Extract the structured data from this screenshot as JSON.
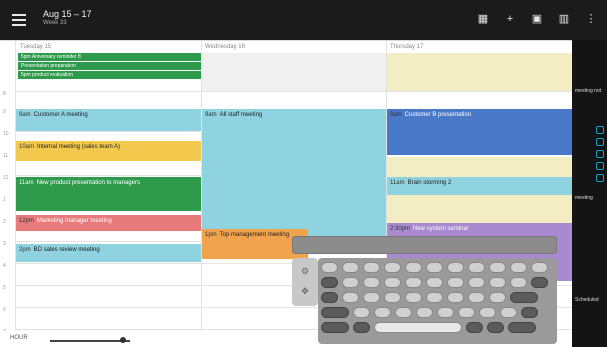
{
  "topbar": {
    "title": "Aug 15 – 17",
    "subtitle": "Week 33",
    "icons": [
      "hamburger-icon",
      "today-icon",
      "add-icon",
      "day-view-icon",
      "week-view-icon",
      "more-icon"
    ]
  },
  "days": [
    "Tuesday 15",
    "Wednesday 16",
    "Thursday 17"
  ],
  "all_day": [
    "5pm Aniversary reminder 8",
    "Presentation preparation",
    "5pm product evaluation"
  ],
  "events": [
    {
      "time": "9am",
      "title": "Customer A meeting"
    },
    {
      "time": "9am",
      "title": "All staff meeting"
    },
    {
      "time": "9am",
      "title": "Customer B presentation"
    },
    {
      "time": "10am",
      "title": "Internal meeting (sales team A)"
    },
    {
      "time": "11am",
      "title": "New product presentation to managers"
    },
    {
      "time": "11am",
      "title": "Brain storming 2"
    },
    {
      "time": "12pm",
      "title": "Marketing manager meeting"
    },
    {
      "time": "1pm",
      "title": "Top management meeting"
    },
    {
      "time": "2:30pm",
      "title": "New system seminar"
    },
    {
      "time": "2pm",
      "title": "BD sales review meeting"
    }
  ],
  "times": [
    "8",
    "9",
    "10",
    "11",
    "12",
    "1",
    "2",
    "3",
    "4",
    "5",
    "6",
    "7"
  ],
  "rightpanel": {
    "label1": "meeting not",
    "label2": "meeting",
    "label3": "Scheduled"
  },
  "bottom": {
    "label": "HOUR"
  }
}
